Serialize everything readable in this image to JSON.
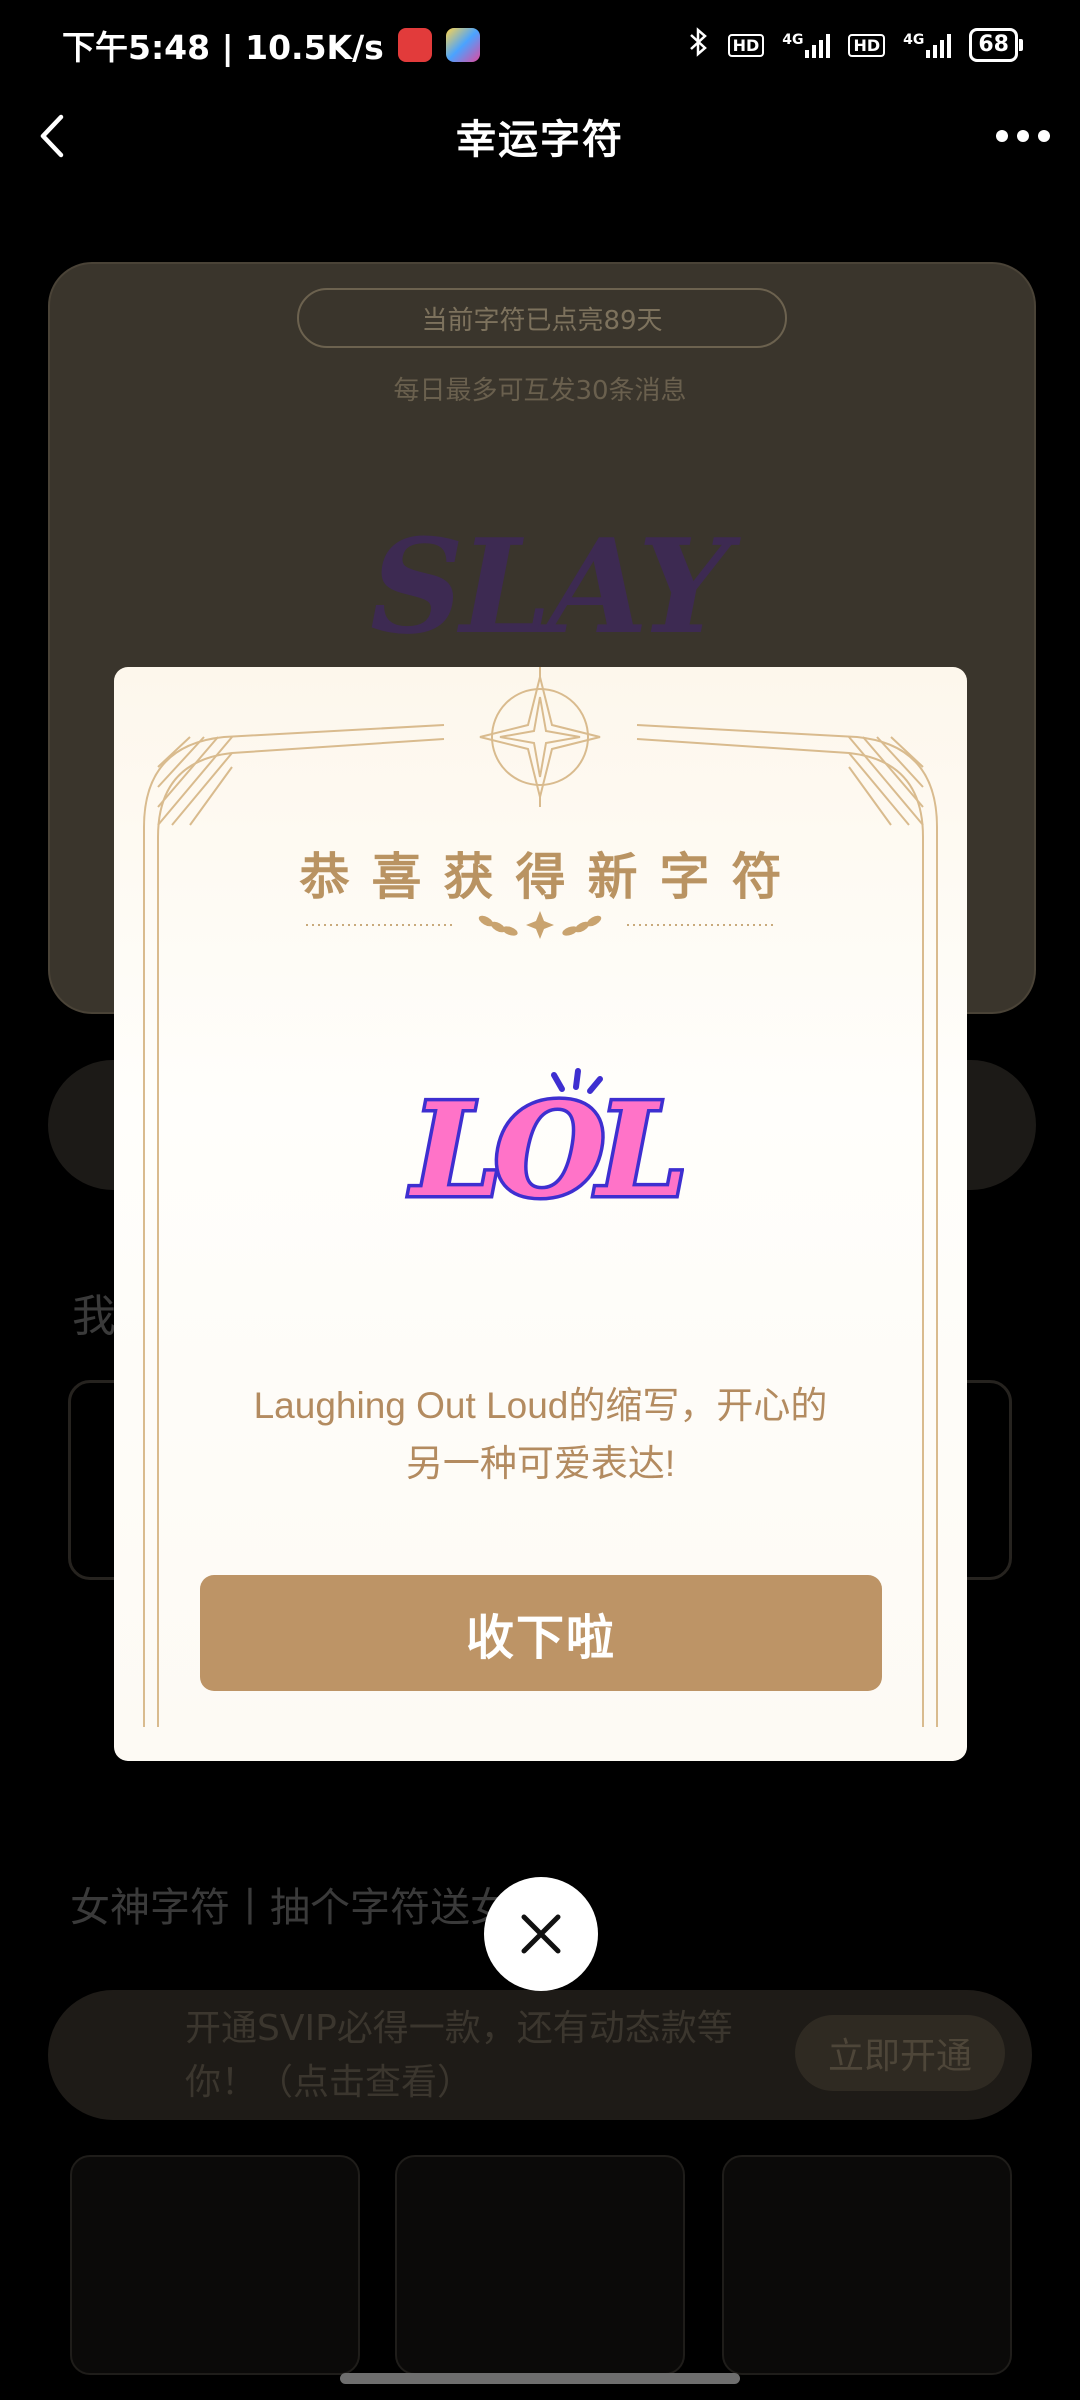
{
  "status_bar": {
    "time_speed": "下午5:48 | 10.5K/s",
    "hd_label": "HD",
    "net_label": "4G",
    "battery": "68"
  },
  "header": {
    "title": "幸运字符"
  },
  "background": {
    "lit_days": "当前字符已点亮89天",
    "daily_limit": "每日最多可互发30条消息",
    "current_glyph": "SLAY",
    "my_heading": "我",
    "goddess_heading": "女神字符丨抽个字符送女神~",
    "svip_text": "开通SVIP必得一款，还有动态款等你！（点击查看）",
    "svip_button": "立即开通"
  },
  "modal": {
    "title": "恭喜获得新字符",
    "glyph_text": "LOL",
    "description_line1": "Laughing Out Loud的缩写，开心的",
    "description_line2": "另一种可爱表达!",
    "accept_button": "收下啦"
  },
  "colors": {
    "gold": "#bd9466",
    "gold_text": "#b99362",
    "glyph_fill": "#ff73c8",
    "glyph_outline": "#3e2fd0"
  }
}
